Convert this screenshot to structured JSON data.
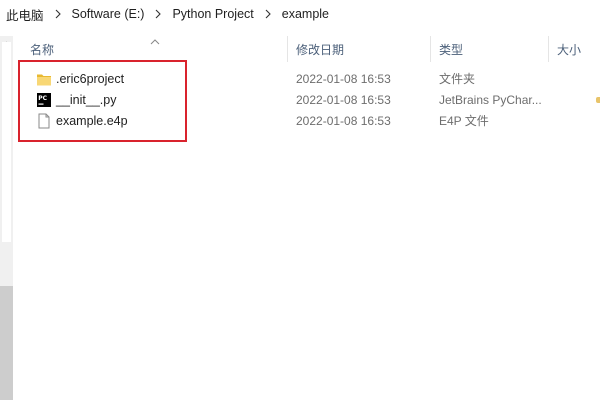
{
  "breadcrumb": {
    "items": [
      "此电脑",
      "Software (E:)",
      "Python Project",
      "example"
    ]
  },
  "columns": {
    "name": "名称",
    "date": "修改日期",
    "type": "类型",
    "size": "大小"
  },
  "files": [
    {
      "name": ".eric6project",
      "date": "2022-01-08 16:53",
      "type": "文件夹",
      "icon": "folder-icon"
    },
    {
      "name": "__init__.py",
      "date": "2022-01-08 16:53",
      "type": "JetBrains PyChar...",
      "icon": "pycharm-file-icon"
    },
    {
      "name": "example.e4p",
      "date": "2022-01-08 16:53",
      "type": "E4P 文件",
      "icon": "generic-file-icon"
    }
  ],
  "colors": {
    "highlight": "#d9232d",
    "header_text": "#4c607a",
    "folder": "#f3c646"
  }
}
